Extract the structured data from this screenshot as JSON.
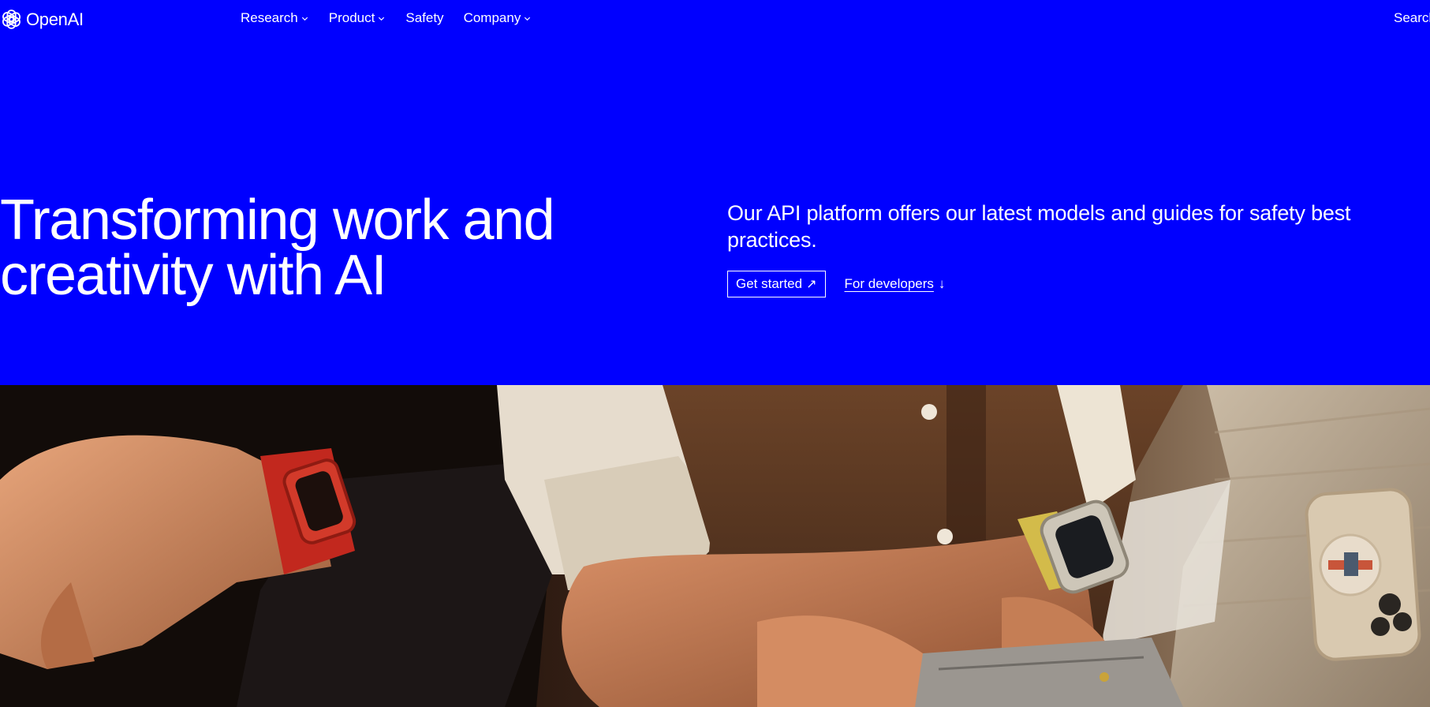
{
  "brand": {
    "name": "OpenAI",
    "logo_icon": "openai-blossom-icon",
    "background_color": "#0000ff",
    "text_color": "#ffffff"
  },
  "nav": {
    "items": [
      {
        "label": "Research",
        "has_dropdown": true
      },
      {
        "label": "Product",
        "has_dropdown": true
      },
      {
        "label": "Safety",
        "has_dropdown": false
      },
      {
        "label": "Company",
        "has_dropdown": true
      }
    ],
    "search_label": "Search"
  },
  "hero": {
    "title_line1": "Transforming work and",
    "title_line2": "creativity with AI",
    "description": "Our API platform offers our latest models and guides for safety best practices.",
    "primary_cta": "Get started",
    "primary_cta_icon": "arrow-up-right-icon",
    "secondary_cta": "For developers",
    "secondary_cta_icon": "arrow-down-icon"
  }
}
